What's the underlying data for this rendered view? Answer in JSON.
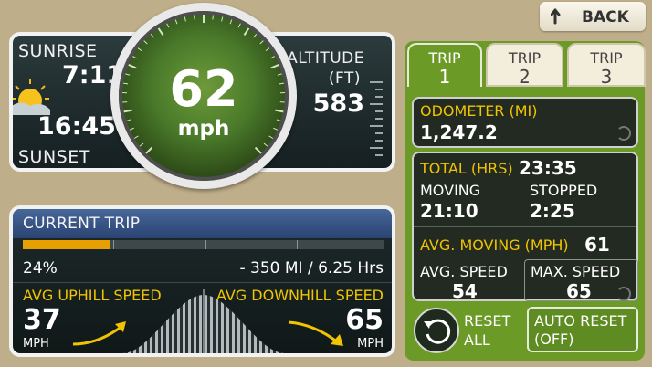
{
  "back_button": {
    "label": "BACK"
  },
  "sun": {
    "sunrise_label": "SUNRISE",
    "sunrise_time": "7:11",
    "sunset_time": "16:45",
    "sunset_label": "SUNSET"
  },
  "speed": {
    "value": "62",
    "unit": "mph"
  },
  "altitude": {
    "label": "ALTITUDE",
    "unit": "(FT)",
    "value": "583"
  },
  "current_trip": {
    "header": "CURRENT TRIP",
    "progress_percent": 24,
    "progress_text": "24%",
    "remaining_text": "- 350 MI / 6.25 Hrs",
    "uphill_label": "AVG UPHILL SPEED",
    "uphill_value": "37",
    "uphill_unit": "MPH",
    "downhill_label": "AVG DOWNHILL SPEED",
    "downhill_value": "65",
    "downhill_unit": "MPH"
  },
  "tabs": [
    {
      "line1": "TRIP",
      "line2": "1",
      "active": true
    },
    {
      "line1": "TRIP",
      "line2": "2",
      "active": false
    },
    {
      "line1": "TRIP",
      "line2": "3",
      "active": false
    }
  ],
  "odometer": {
    "label": "ODOMETER (MI)",
    "value": "1,247.2"
  },
  "trip_stats": {
    "total_label": "TOTAL (HRS)",
    "total_value": "23:35",
    "moving_label": "MOVING",
    "moving_value": "21:10",
    "stopped_label": "STOPPED",
    "stopped_value": "2:25",
    "avg_moving_label": "AVG. MOVING (MPH)",
    "avg_moving_value": "61",
    "avg_speed_label": "AVG. SPEED",
    "avg_speed_value": "54",
    "max_speed_label": "MAX. SPEED",
    "max_speed_value": "65"
  },
  "reset_all": {
    "line1": "RESET",
    "line2": "ALL"
  },
  "auto_reset": {
    "line1": "AUTO RESET",
    "line2": "(OFF)"
  },
  "colors": {
    "accent_green": "#6b9a27",
    "yellow": "#f0c400",
    "orange": "#e8a000",
    "header_blue": "#3a5a8c"
  }
}
